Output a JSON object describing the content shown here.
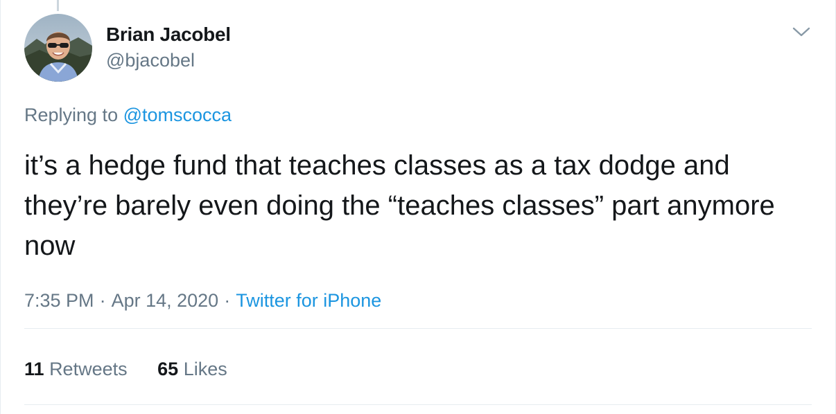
{
  "author": {
    "display_name": "Brian Jacobel",
    "handle": "@bjacobel",
    "avatar_icon": "profile-photo"
  },
  "reply": {
    "prefix": "Replying to",
    "to_handle": "@tomscocca"
  },
  "tweet": {
    "text": "it’s a hedge fund that teaches classes as a tax dodge and they’re barely even doing the “teaches classes” part anymore now"
  },
  "meta": {
    "time": "7:35 PM",
    "separator": "·",
    "date": "Apr 14, 2020",
    "source": "Twitter for iPhone"
  },
  "stats": {
    "retweets_count": "11",
    "retweets_label": "Retweets",
    "likes_count": "65",
    "likes_label": "Likes"
  },
  "menu": {
    "icon": "chevron-down-icon"
  },
  "colors": {
    "link": "#1b95e0",
    "secondary_text": "#657786",
    "primary_text": "#14171a",
    "divider": "#e6ecf0"
  }
}
